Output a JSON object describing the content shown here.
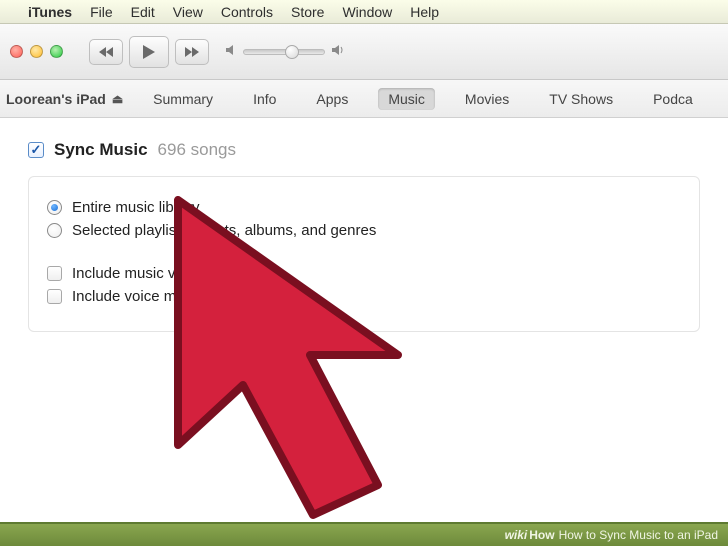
{
  "menubar": {
    "app": "iTunes",
    "items": [
      "File",
      "Edit",
      "View",
      "Controls",
      "Store",
      "Window",
      "Help"
    ]
  },
  "device": {
    "name": "Loorean's iPad",
    "tabs": [
      "Summary",
      "Info",
      "Apps",
      "Music",
      "Movies",
      "TV Shows",
      "Podca"
    ],
    "active_tab_index": 3
  },
  "sync": {
    "title": "Sync Music",
    "count": "696 songs",
    "radio_entire": "Entire music library",
    "radio_selected": "Selected playlists, artists, albums, and genres",
    "radio_choice": 0,
    "include_videos": "Include music videos",
    "include_memos": "Include voice memos"
  },
  "footer": {
    "brand_wiki": "wiki",
    "brand_how": "How",
    "text": "How to Sync Music to an iPad"
  }
}
